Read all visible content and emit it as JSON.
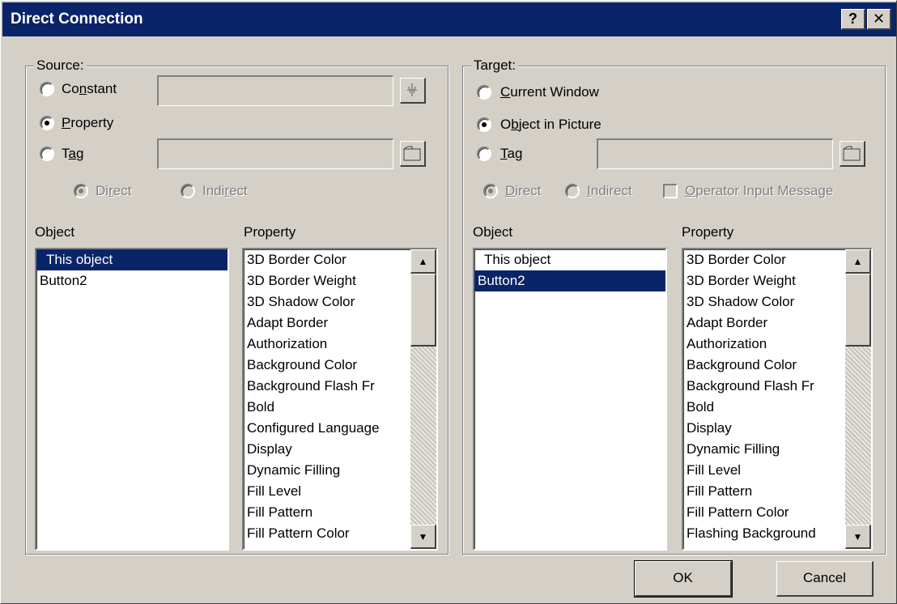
{
  "window": {
    "title": "Direct Connection",
    "help": "?",
    "close": "✕"
  },
  "source": {
    "legend": "Source:",
    "constant_pre": "Co",
    "constant_u": "n",
    "constant_post": "stant",
    "property_pre": "",
    "property_u": "P",
    "property_post": "roperty",
    "tag_pre": "T",
    "tag_u": "a",
    "tag_post": "g",
    "direct_pre": "Di",
    "direct_u": "r",
    "direct_post": "ect",
    "indirect_pre": "Indi",
    "indirect_u": "r",
    "indirect_post": "ect",
    "object_header": "Object",
    "property_header": "Property",
    "objects": [
      "This object",
      "Button2"
    ],
    "properties": [
      "3D Border Color",
      "3D Border Weight",
      "3D Shadow Color",
      "Adapt Border",
      "Authorization",
      "Background Color",
      "Background Flash Fr",
      "Bold",
      "Configured Language",
      "Display",
      "Dynamic Filling",
      "Fill Level",
      "Fill Pattern",
      "Fill Pattern Color"
    ]
  },
  "target": {
    "legend": "Target:",
    "current_window_pre": "",
    "current_window_u": "C",
    "current_window_post": "urrent Window",
    "object_in_picture_pre": "O",
    "object_in_picture_u": "b",
    "object_in_picture_post": "ject in Picture",
    "tag_pre": "",
    "tag_u": "T",
    "tag_post": "ag",
    "direct_pre": "",
    "direct_u": "D",
    "direct_post": "irect",
    "indirect_pre": "",
    "indirect_u": "I",
    "indirect_post": "ndirect",
    "operator_pre": "",
    "operator_u": "O",
    "operator_post": "perator Input Message",
    "object_header": "Object",
    "property_header": "Property",
    "objects": [
      "This object",
      "Button2"
    ],
    "properties": [
      "3D Border Color",
      "3D Border Weight",
      "3D Shadow Color",
      "Adapt Border",
      "Authorization",
      "Background Color",
      "Background Flash Fr",
      "Bold",
      "Display",
      "Dynamic Filling",
      "Fill Level",
      "Fill Pattern",
      "Fill Pattern Color",
      "Flashing Background"
    ]
  },
  "buttons": {
    "ok": "OK",
    "cancel": "Cancel"
  }
}
